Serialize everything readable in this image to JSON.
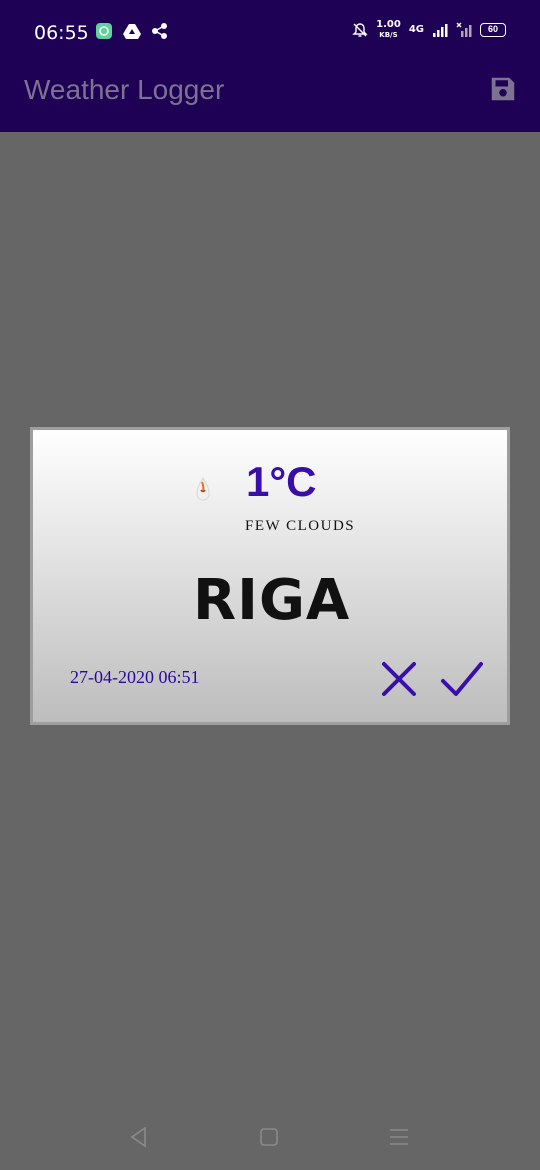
{
  "status_bar": {
    "time": "06:55",
    "speed_value": "1.00",
    "speed_unit": "KB/S",
    "network": "4G",
    "battery": "60"
  },
  "app_bar": {
    "title": "Weather Logger",
    "save_icon": "save-icon"
  },
  "dialog": {
    "temperature": "1°C",
    "description": "FEW CLOUDS",
    "city": "RIGA",
    "datetime": "27-04-2020 06:51",
    "weather_icon": "weather-icon",
    "cancel_icon": "close-icon",
    "confirm_icon": "check-icon"
  },
  "colors": {
    "app_bar": "#1e0155",
    "background": "#666666",
    "accent": "#3a0ea8"
  },
  "nav_bar": {
    "back_icon": "back-icon",
    "home_icon": "home-icon",
    "recent_icon": "recent-apps-icon"
  }
}
